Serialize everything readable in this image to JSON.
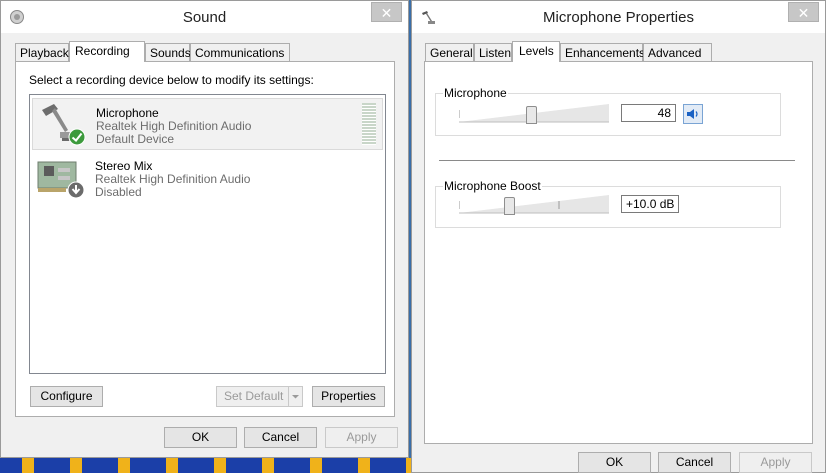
{
  "sound_window": {
    "title": "Sound",
    "close_glyph": "✕",
    "tabs": [
      {
        "label": "Playback"
      },
      {
        "label": "Recording"
      },
      {
        "label": "Sounds"
      },
      {
        "label": "Communications"
      }
    ],
    "instruction": "Select a recording device below to modify its settings:",
    "devices": [
      {
        "name": "Microphone",
        "driver": "Realtek High Definition Audio",
        "status": "Default Device",
        "icon": "microphone-icon",
        "badge": "default-check-icon"
      },
      {
        "name": "Stereo Mix",
        "driver": "Realtek High Definition Audio",
        "status": "Disabled",
        "icon": "sound-card-icon",
        "badge": "disabled-arrow-icon"
      }
    ],
    "buttons": {
      "configure": "Configure",
      "set_default": "Set Default",
      "properties": "Properties",
      "ok": "OK",
      "cancel": "Cancel",
      "apply": "Apply"
    }
  },
  "mic_window": {
    "title": "Microphone Properties",
    "close_glyph": "✕",
    "tabs": [
      {
        "label": "General"
      },
      {
        "label": "Listen"
      },
      {
        "label": "Levels"
      },
      {
        "label": "Enhancements"
      },
      {
        "label": "Advanced"
      }
    ],
    "microphone": {
      "label": "Microphone",
      "value": "48",
      "level_fraction": 0.48
    },
    "boost": {
      "label": "Microphone Boost",
      "value": "+10.0 dB",
      "level_fraction": 0.33
    },
    "buttons": {
      "ok": "OK",
      "cancel": "Cancel",
      "apply": "Apply"
    }
  },
  "colors": {
    "accent_check": "#3c9a3c",
    "speaker_blue": "#1b62c4",
    "window_bg": "#f0f0f0"
  }
}
